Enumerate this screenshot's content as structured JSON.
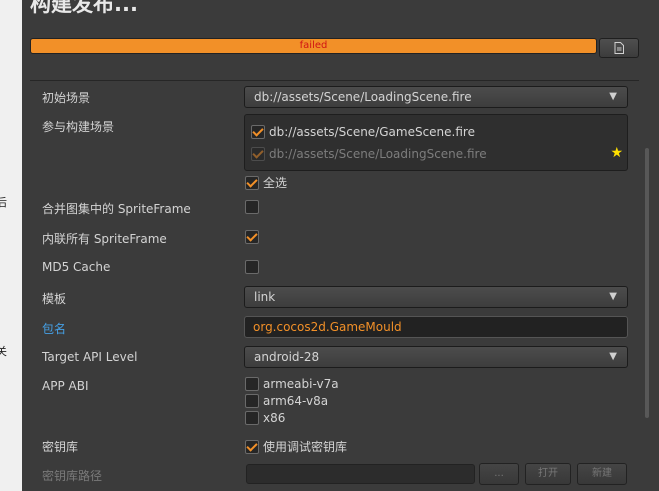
{
  "title": "构建发布...",
  "progress": {
    "status": "failed",
    "percent": 100
  },
  "left_fragments": [
    "后",
    "关"
  ],
  "fields": {
    "start_scene": {
      "label": "初始场景",
      "value": "db://assets/Scene/LoadingScene.fire"
    },
    "build_scenes": {
      "label": "参与构建场景",
      "items": [
        {
          "name": "db://assets/Scene/GameScene.fire",
          "checked": true
        },
        {
          "name": "db://assets/Scene/LoadingScene.fire",
          "checked": true
        }
      ],
      "select_all": "全选"
    },
    "merge_sf": {
      "label": "合并图集中的 SpriteFrame"
    },
    "inline_sf": {
      "label": "内联所有 SpriteFrame"
    },
    "md5": {
      "label": "MD5 Cache"
    },
    "template": {
      "label": "模板",
      "value": "link"
    },
    "package": {
      "label": "包名",
      "value": "org.cocos2d.GameMould"
    },
    "api": {
      "label": "Target API Level",
      "value": "android-28"
    },
    "abi": {
      "label": "APP ABI",
      "options": [
        "armeabi-v7a",
        "arm64-v8a",
        "x86"
      ]
    },
    "keystore": {
      "label": "密钥库",
      "option": "使用调试密钥库"
    },
    "keystore_path": {
      "label": "密钥库路径",
      "browse": "...",
      "open": "打开",
      "new": "新建"
    }
  },
  "colors": {
    "accent": "#f29028",
    "link_label": "#45a0e6",
    "error_text": "#d01414"
  }
}
